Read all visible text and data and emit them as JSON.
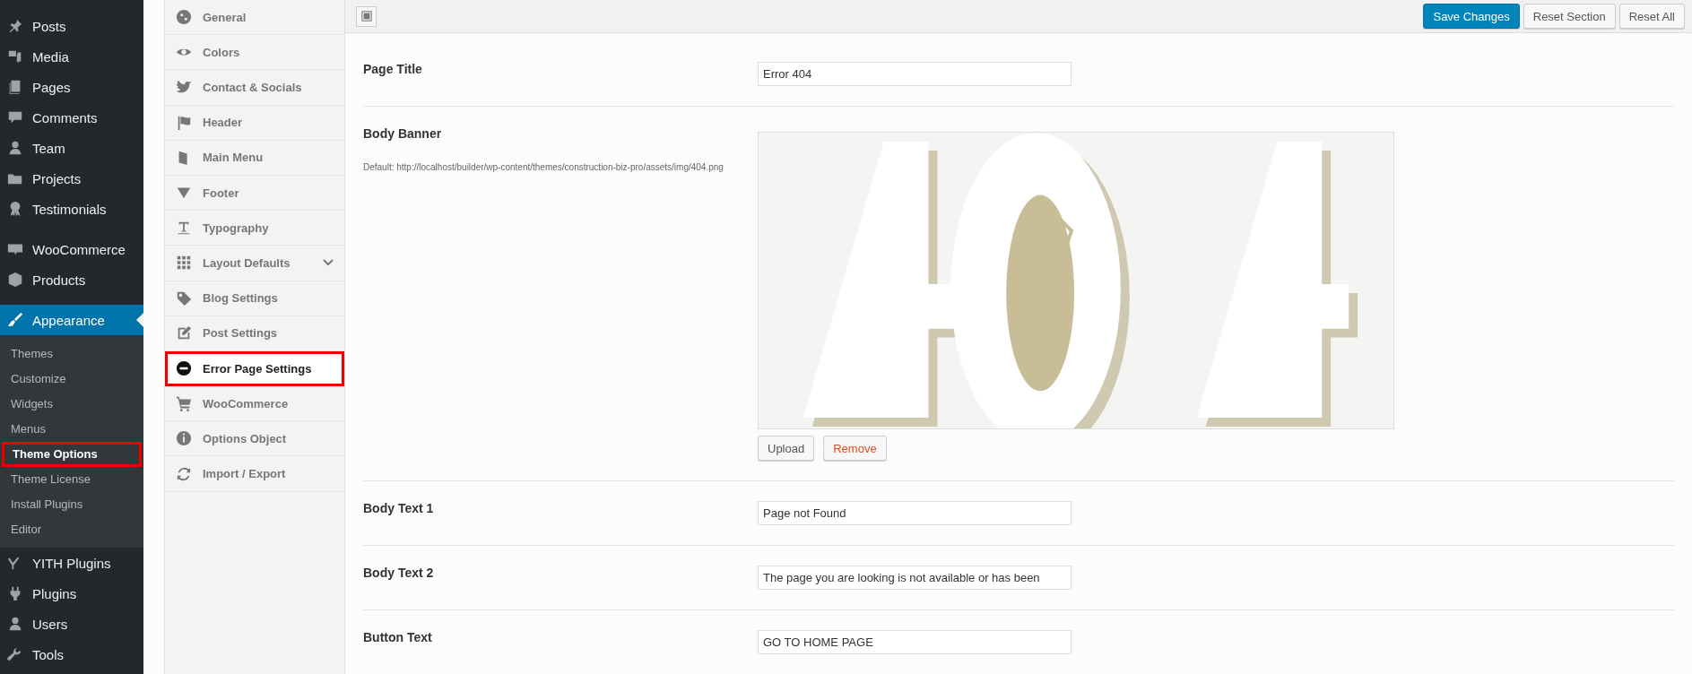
{
  "admin_menu": {
    "groups": [
      {
        "items": [
          {
            "label": "Posts",
            "selected": false
          },
          {
            "label": "Media",
            "selected": false
          },
          {
            "label": "Pages",
            "selected": false
          },
          {
            "label": "Comments",
            "selected": false
          },
          {
            "label": "Team",
            "selected": false
          },
          {
            "label": "Projects",
            "selected": false
          },
          {
            "label": "Testimonials",
            "selected": false
          }
        ]
      },
      {
        "items": [
          {
            "label": "WooCommerce",
            "selected": false
          },
          {
            "label": "Products",
            "selected": false
          }
        ]
      },
      {
        "items": [
          {
            "label": "Appearance",
            "selected": true,
            "children": [
              {
                "label": "Themes",
                "selected": false,
                "highlighted": false
              },
              {
                "label": "Customize",
                "selected": false,
                "highlighted": false
              },
              {
                "label": "Widgets",
                "selected": false,
                "highlighted": false
              },
              {
                "label": "Menus",
                "selected": false,
                "highlighted": false
              },
              {
                "label": "Theme Options",
                "selected": true,
                "highlighted": true
              },
              {
                "label": "Theme License",
                "selected": false,
                "highlighted": false
              },
              {
                "label": "Install Plugins",
                "selected": false,
                "highlighted": false
              },
              {
                "label": "Editor",
                "selected": false,
                "highlighted": false
              }
            ]
          },
          {
            "label": "YITH Plugins",
            "selected": false
          },
          {
            "label": "Plugins",
            "selected": false
          },
          {
            "label": "Users",
            "selected": false
          },
          {
            "label": "Tools",
            "selected": false
          }
        ]
      }
    ]
  },
  "options_menu": {
    "items": [
      {
        "label": "General",
        "selected": false,
        "highlighted": false,
        "expandable": false
      },
      {
        "label": "Colors",
        "selected": false,
        "highlighted": false,
        "expandable": false
      },
      {
        "label": "Contact & Socials",
        "selected": false,
        "highlighted": false,
        "expandable": false
      },
      {
        "label": "Header",
        "selected": false,
        "highlighted": false,
        "expandable": false
      },
      {
        "label": "Main Menu",
        "selected": false,
        "highlighted": false,
        "expandable": false
      },
      {
        "label": "Footer",
        "selected": false,
        "highlighted": false,
        "expandable": false
      },
      {
        "label": "Typography",
        "selected": false,
        "highlighted": false,
        "expandable": false
      },
      {
        "label": "Layout Defaults",
        "selected": false,
        "highlighted": false,
        "expandable": true
      },
      {
        "label": "Blog Settings",
        "selected": false,
        "highlighted": false,
        "expandable": false
      },
      {
        "label": "Post Settings",
        "selected": false,
        "highlighted": false,
        "expandable": false
      },
      {
        "label": "Error Page Settings",
        "selected": true,
        "highlighted": true,
        "expandable": false
      },
      {
        "label": "WooCommerce",
        "selected": false,
        "highlighted": false,
        "expandable": false
      },
      {
        "label": "Options Object",
        "selected": false,
        "highlighted": false,
        "expandable": false
      },
      {
        "label": "Import / Export",
        "selected": false,
        "highlighted": false,
        "expandable": false
      }
    ]
  },
  "toolbar": {
    "buttons": [
      {
        "label": "Save Changes",
        "kind": "primary"
      },
      {
        "label": "Reset Section",
        "kind": "default"
      },
      {
        "label": "Reset All",
        "kind": "default"
      }
    ]
  },
  "fields": [
    {
      "kind": "text",
      "label": "Page Title",
      "value": "Error 404"
    },
    {
      "kind": "media",
      "label": "Body Banner",
      "description": "Default: http://localhost/builder/wp-content/themes/construction-biz-pro/assets/img/404.png",
      "preview": {
        "kind": "picture"
      },
      "buttons": [
        {
          "label": "Upload",
          "kind": "default"
        },
        {
          "label": "Remove",
          "kind": "danger"
        }
      ]
    },
    {
      "kind": "text",
      "label": "Body Text 1",
      "value": "Page not Found"
    },
    {
      "kind": "text",
      "label": "Body Text 2",
      "value": "The page you are looking is not available or has been"
    },
    {
      "kind": "text",
      "label": "Button Text",
      "value": "GO TO HOME PAGE"
    }
  ]
}
